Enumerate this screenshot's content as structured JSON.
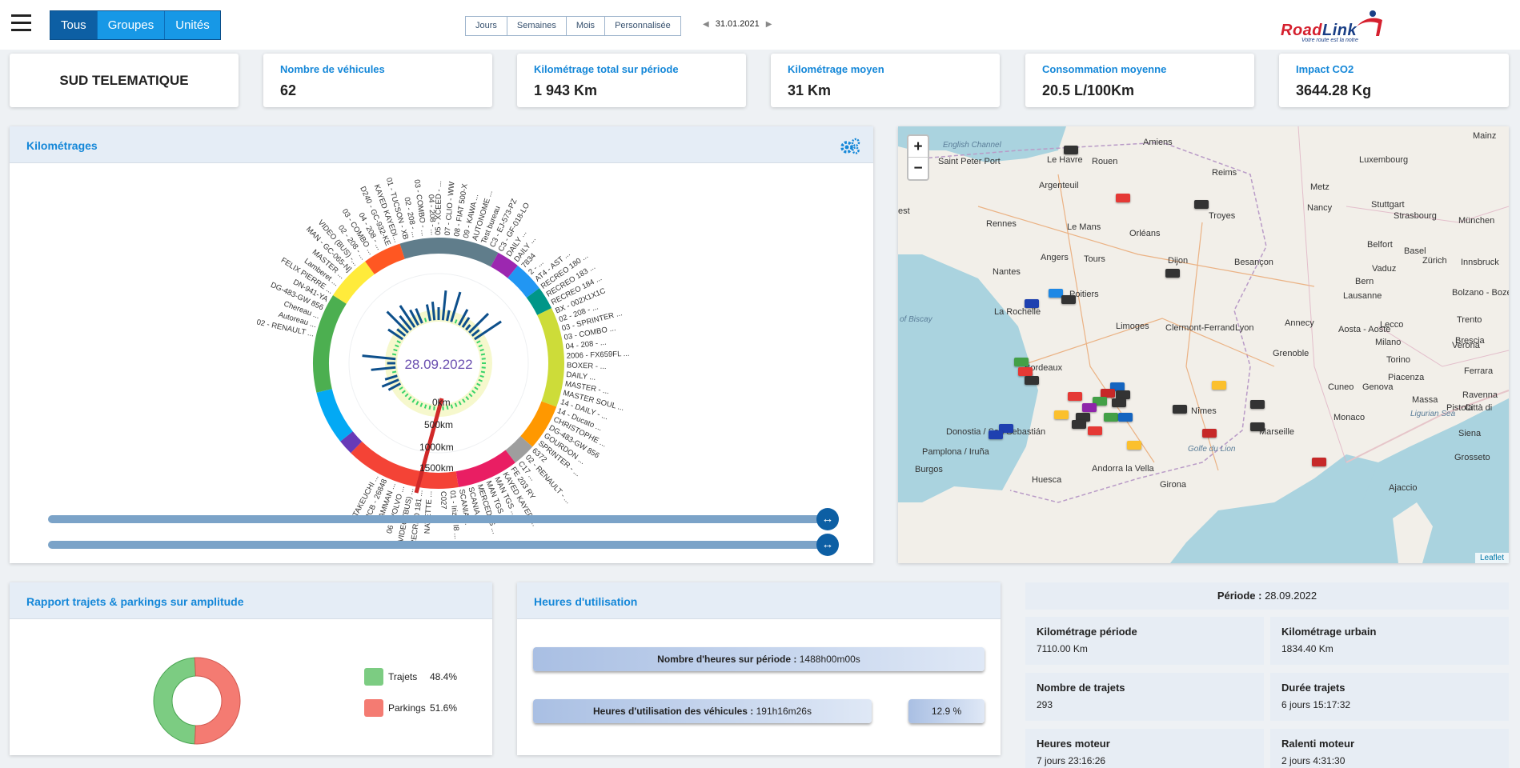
{
  "header": {
    "menu_icon": "hamburger-icon",
    "scope_tabs": [
      "Tous",
      "Groupes",
      "Unités"
    ],
    "period_tabs": [
      "Jours",
      "Semaines",
      "Mois",
      "Personnalisée"
    ],
    "current_date": "31.01.2021",
    "logo": {
      "text_red": "Road",
      "text_blue": "Link",
      "slogan": "Votre route est la notre"
    }
  },
  "kpis": {
    "company": "SUD TELEMATIQUE",
    "vehicles": {
      "label": "Nombre de véhicules",
      "value": "62"
    },
    "total_km": {
      "label": "Kilométrage total sur période",
      "value": "1 943 Km"
    },
    "avg_km": {
      "label": "Kilométrage moyen",
      "value": "31 Km"
    },
    "consumption": {
      "label": "Consommation moyenne",
      "value": "20.5 L/100Km"
    },
    "co2": {
      "label": "Impact CO2",
      "value": "3644.28 Kg"
    }
  },
  "km_panel": {
    "title": "Kilométrages",
    "settings_icon": "gears-icon",
    "center_date": "28.09.2022",
    "scale_labels": [
      "0km",
      "500km",
      "1000km",
      "1500km"
    ],
    "vehicle_labels": [
      "02 - RENAULT ...",
      "Autoreau ...",
      "Chereau ...",
      "DG-483-GW 856",
      "DN-941-YA",
      "FELIX PIERRE ...",
      "Lamberet ...",
      "MASTER ...",
      "MAN - GC-065-N]",
      "VIDEO (BUS) -...",
      "02 - 208 - ...",
      "03 - COMBO ...",
      "04 - 208 - ...",
      "D240 - GC-932-KE",
      "KAYED KAYEDI...",
      "01 - TUCSON - XB",
      "02 - 208 - ...",
      "03 - COMBO - ...",
      "04 - 208 - ...",
      "05 - XCEED - ...",
      "07 - CLIO - WW",
      "08 - FIAT 500-X",
      "09 - KAWA ...",
      "AUTONOME ...",
      "Test bureau",
      "C3 - EJ-573-PZ",
      "C3 - GF-018-LO",
      "DAILY ...",
      "DAILY ...",
      "7834",
      "2 - ...",
      "AT4 - AST ...",
      "RECREO 180 ...",
      "RECREO 183 ...",
      "RECREO 184 ...",
      "BX - 002X1X1C",
      "02 - 208 - ...",
      "03 - SPRINTER ...",
      "03 - COMBO ...",
      "04 - 208 - ...",
      "2006 - FX659FL ...",
      "BOXER - ...",
      "DAILY ...",
      "MASTER - ...",
      "MASTER SOUL ...",
      "14 - DAILY - ...",
      "14 - Ducato ...",
      "CHRISTOPHE ...",
      "DG-483-GW 856",
      "GOURDON ...",
      "SPRINTER - ...",
      "6372",
      "02 - RENAULT - ...",
      "C17 ...",
      "FE 203 RY",
      "KAYED KAYEDI...",
      "MAN TGS ...",
      "MAN TGS ...",
      "MERCEDES ...",
      "SCANIA ...",
      "SCANIA ...",
      "01 - Irizar I8 ...",
      "C027",
      "NAVETTE ...",
      "RECREO 181 ...",
      "VIDEO (BUS) ...",
      "06 - VOLVO ...",
      "AMMAN ...",
      "MCB - 26848",
      "TAKEUCHI ..."
    ]
  },
  "map": {
    "zoom_in": "+",
    "zoom_out": "−",
    "attribution": "Leaflet",
    "places": [
      "English Channel",
      "Amiens",
      "Mainz",
      "Saint Peter Port",
      "Le Havre",
      "Rouen",
      "Luxembourg",
      "Reims",
      "Metz",
      "Argenteuil",
      "Nancy",
      "Stuttgart",
      "Rennes",
      "Le Mans",
      "Orléans",
      "Troyes",
      "Strasbourg",
      "München",
      "Belfort",
      "Basel",
      "Zürich",
      "Innsbruck",
      "Nantes",
      "Angers",
      "Tours",
      "Dijon",
      "Besançon",
      "Bern",
      "Vaduz",
      "Poitiers",
      "Lausanne",
      "Bolzano - Bozen",
      "La Rochelle",
      "of Biscay",
      "Limoges",
      "Clermont-Ferrand",
      "Lyon",
      "Annecy",
      "Aosta - Aoste",
      "Lecco",
      "Trento",
      "Brescia",
      "Milano",
      "Verona",
      "Grenoble",
      "Torino",
      "Piacenza",
      "Ferrara",
      "Cuneo",
      "Genova",
      "Ravenna",
      "Nîmes",
      "Ligurian Sea",
      "Massa",
      "Città di",
      "Monaco",
      "Pistoia",
      "Siena",
      "Grosseto",
      "Donostia / San Sebastián",
      "Marseille",
      "Golfe du Lion",
      "Pamplona / Iruña",
      "Burgos",
      "Andorra la Vella",
      "Huesca",
      "Girona",
      "Ajaccio",
      "Bordeaux",
      "est"
    ]
  },
  "trips_panel": {
    "title": "Rapport trajets & parkings sur amplitude",
    "legend": [
      {
        "label": "Trajets",
        "value": "48.4%",
        "fraction": 0.484,
        "color": "#7ccc82"
      },
      {
        "label": "Parkings",
        "value": "51.6%",
        "fraction": 0.516,
        "color": "#f47b72"
      }
    ]
  },
  "usage_panel": {
    "title": "Heures d'utilisation",
    "total_hours_label": "Nombre d'heures sur période :",
    "total_hours_value": "1488h00m00s",
    "vehicle_hours_label": "Heures d'utilisation des véhicules :",
    "vehicle_hours_value": "191h16m26s",
    "usage_percent": "12.9 %"
  },
  "stats": {
    "period_label": "Période :",
    "period_value": "28.09.2022",
    "items": [
      {
        "label": "Kilométrage période",
        "value": "7110.00 Km"
      },
      {
        "label": "Kilométrage urbain",
        "value": "1834.40 Km"
      },
      {
        "label": "Nombre de trajets",
        "value": "293"
      },
      {
        "label": "Durée trajets",
        "value": "6 jours 15:17:32"
      },
      {
        "label": "Heures moteur",
        "value": "7 jours 23:16:26"
      },
      {
        "label": "Ralenti moteur",
        "value": "2 jours 4:31:30"
      }
    ]
  },
  "colors": {
    "accent": "#1487d8",
    "header_bg": "#e5edf6",
    "slider": "#7ba3c8",
    "handle": "#0d5fa4"
  }
}
